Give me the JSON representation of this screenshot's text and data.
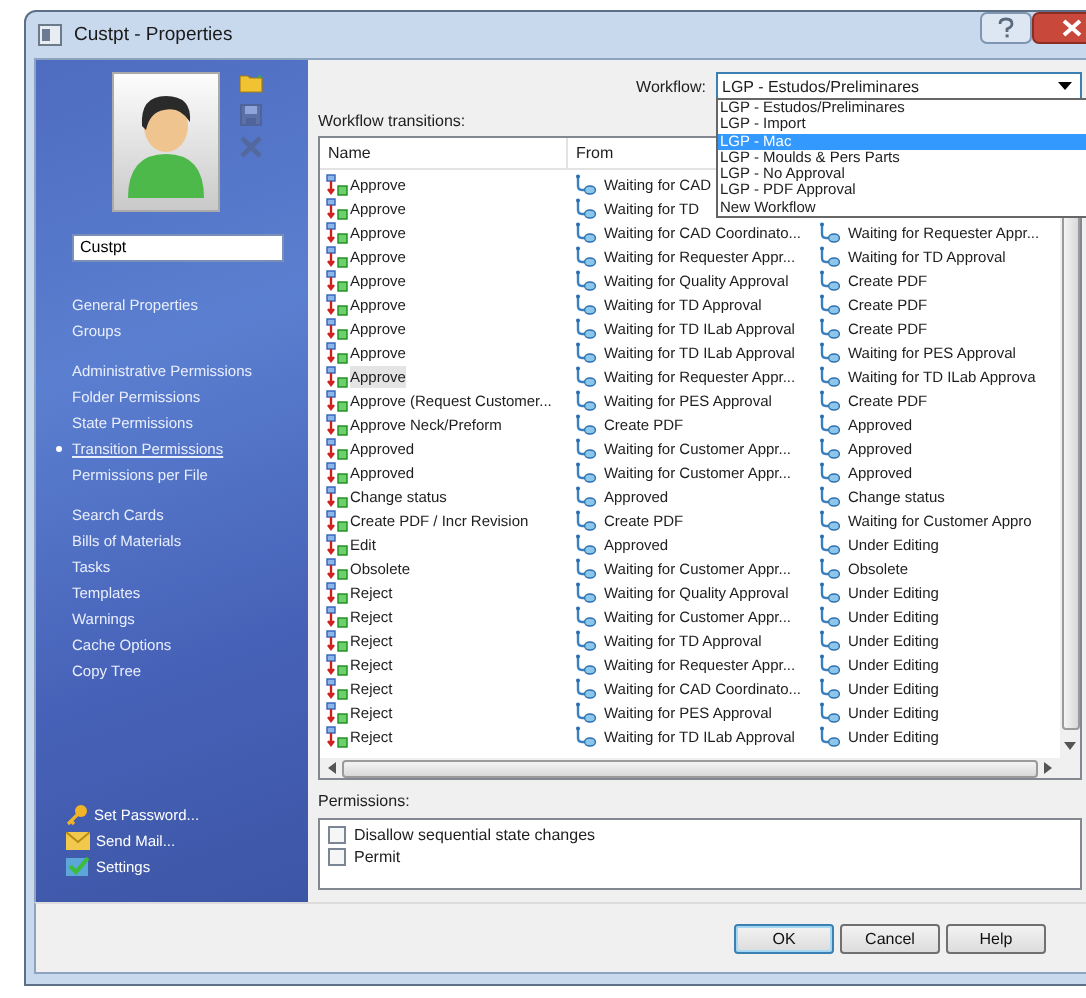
{
  "window": {
    "title": "Custpt - Properties"
  },
  "sidebar": {
    "user_name": "Custpt",
    "actions": [
      {
        "kind": "folder",
        "disabled": false
      },
      {
        "kind": "save",
        "disabled": true
      },
      {
        "kind": "delete",
        "disabled": true
      }
    ],
    "nav_groups": [
      {
        "items": [
          {
            "label": "General Properties",
            "selected": false
          },
          {
            "label": "Groups",
            "selected": false
          }
        ]
      },
      {
        "items": [
          {
            "label": "Administrative Permissions",
            "selected": false
          },
          {
            "label": "Folder Permissions",
            "selected": false
          },
          {
            "label": "State Permissions",
            "selected": false
          },
          {
            "label": "Transition Permissions",
            "selected": true
          },
          {
            "label": "Permissions per File",
            "selected": false
          }
        ]
      },
      {
        "items": [
          {
            "label": "Search Cards",
            "selected": false
          },
          {
            "label": "Bills of Materials",
            "selected": false
          },
          {
            "label": "Tasks",
            "selected": false
          },
          {
            "label": "Templates",
            "selected": false
          },
          {
            "label": "Warnings",
            "selected": false
          },
          {
            "label": "Cache Options",
            "selected": false
          },
          {
            "label": "Copy Tree",
            "selected": false
          }
        ]
      }
    ],
    "links": [
      {
        "kind": "key",
        "label": "Set Password..."
      },
      {
        "kind": "mail",
        "label": "Send Mail..."
      },
      {
        "kind": "settings",
        "label": "Settings"
      }
    ]
  },
  "workflow": {
    "label": "Workflow:",
    "value": "LGP - Estudos/Preliminares",
    "expanded": true,
    "options": [
      {
        "label": "LGP - Estudos/Preliminares",
        "highlighted": false
      },
      {
        "label": "LGP - Import",
        "highlighted": false
      },
      {
        "label": "LGP - Mac",
        "highlighted": true
      },
      {
        "label": "LGP - Moulds & Pers Parts",
        "highlighted": false
      },
      {
        "label": "LGP - No Approval",
        "highlighted": false
      },
      {
        "label": "LGP - PDF Approval",
        "highlighted": false
      },
      {
        "label": "New Workflow",
        "highlighted": false
      }
    ]
  },
  "transitions": {
    "label": "Workflow transitions:",
    "columns": [
      "Name",
      "From"
    ],
    "rows": [
      {
        "name": "Approve",
        "from": "Waiting for CAD",
        "selected": false
      },
      {
        "name": "Approve",
        "from": "Waiting for TD",
        "selected": false
      },
      {
        "name": "Approve",
        "from": "Waiting for CAD Coordinato...",
        "to": "Waiting for Requester Appr...",
        "selected": false
      },
      {
        "name": "Approve",
        "from": "Waiting for Requester Appr...",
        "to": "Waiting for TD Approval",
        "selected": false
      },
      {
        "name": "Approve",
        "from": "Waiting for Quality Approval",
        "to": "Create PDF",
        "selected": false
      },
      {
        "name": "Approve",
        "from": "Waiting for TD Approval",
        "to": "Create PDF",
        "selected": false
      },
      {
        "name": "Approve",
        "from": "Waiting for TD ILab Approval",
        "to": "Create PDF",
        "selected": false
      },
      {
        "name": "Approve",
        "from": "Waiting for TD ILab Approval",
        "to": "Waiting for PES Approval",
        "selected": false
      },
      {
        "name": "Approve",
        "from": "Waiting for Requester Appr...",
        "to": "Waiting for TD ILab Approva",
        "selected": true
      },
      {
        "name": "Approve (Request Customer...",
        "from": "Waiting for PES Approval",
        "to": "Create PDF",
        "selected": false
      },
      {
        "name": "Approve Neck/Preform",
        "from": "Create PDF",
        "to": "Approved",
        "selected": false
      },
      {
        "name": "Approved",
        "from": "Waiting for Customer Appr...",
        "to": "Approved",
        "selected": false
      },
      {
        "name": "Approved",
        "from": "Waiting for Customer Appr...",
        "to": "Approved",
        "selected": false
      },
      {
        "name": "Change status",
        "from": "Approved",
        "to": "Change status",
        "selected": false
      },
      {
        "name": "Create PDF / Incr Revision",
        "from": "Create PDF",
        "to": "Waiting for Customer Appro",
        "selected": false
      },
      {
        "name": "Edit",
        "from": "Approved",
        "to": "Under Editing",
        "selected": false
      },
      {
        "name": "Obsolete",
        "from": "Waiting for Customer Appr...",
        "to": "Obsolete",
        "selected": false
      },
      {
        "name": "Reject",
        "from": "Waiting for Quality Approval",
        "to": "Under Editing",
        "selected": false
      },
      {
        "name": "Reject",
        "from": "Waiting for Customer Appr...",
        "to": "Under Editing",
        "selected": false
      },
      {
        "name": "Reject",
        "from": "Waiting for TD Approval",
        "to": "Under Editing",
        "selected": false
      },
      {
        "name": "Reject",
        "from": "Waiting for Requester Appr...",
        "to": "Under Editing",
        "selected": false
      },
      {
        "name": "Reject",
        "from": "Waiting for CAD Coordinato...",
        "to": "Under Editing",
        "selected": false
      },
      {
        "name": "Reject",
        "from": "Waiting for PES Approval",
        "to": "Under Editing",
        "selected": false
      },
      {
        "name": "Reject",
        "from": "Waiting for TD ILab Approval",
        "to": "Under Editing",
        "selected": false
      }
    ]
  },
  "permissions": {
    "label": "Permissions:",
    "items": [
      {
        "label": "Disallow sequential state changes",
        "checked": false
      },
      {
        "label": "Permit",
        "checked": false
      }
    ]
  },
  "buttons": [
    {
      "label": "OK",
      "default": true
    },
    {
      "label": "Cancel",
      "default": false
    },
    {
      "label": "Help",
      "default": false
    }
  ]
}
